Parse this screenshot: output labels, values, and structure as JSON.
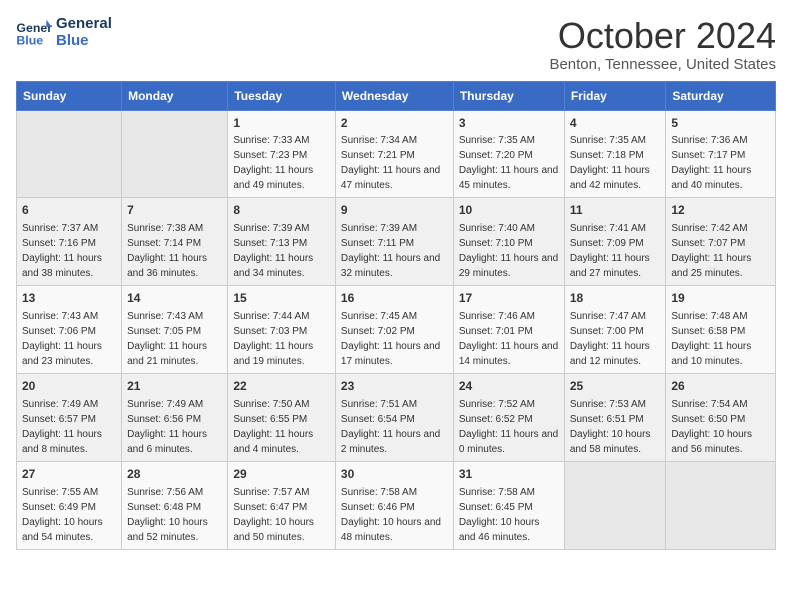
{
  "header": {
    "logo_line1": "General",
    "logo_line2": "Blue",
    "title": "October 2024",
    "subtitle": "Benton, Tennessee, United States"
  },
  "days_of_week": [
    "Sunday",
    "Monday",
    "Tuesday",
    "Wednesday",
    "Thursday",
    "Friday",
    "Saturday"
  ],
  "weeks": [
    [
      {
        "day": "",
        "info": ""
      },
      {
        "day": "",
        "info": ""
      },
      {
        "day": "1",
        "sunrise": "7:33 AM",
        "sunset": "7:23 PM",
        "daylight": "11 hours and 49 minutes."
      },
      {
        "day": "2",
        "sunrise": "7:34 AM",
        "sunset": "7:21 PM",
        "daylight": "11 hours and 47 minutes."
      },
      {
        "day": "3",
        "sunrise": "7:35 AM",
        "sunset": "7:20 PM",
        "daylight": "11 hours and 45 minutes."
      },
      {
        "day": "4",
        "sunrise": "7:35 AM",
        "sunset": "7:18 PM",
        "daylight": "11 hours and 42 minutes."
      },
      {
        "day": "5",
        "sunrise": "7:36 AM",
        "sunset": "7:17 PM",
        "daylight": "11 hours and 40 minutes."
      }
    ],
    [
      {
        "day": "6",
        "sunrise": "7:37 AM",
        "sunset": "7:16 PM",
        "daylight": "11 hours and 38 minutes."
      },
      {
        "day": "7",
        "sunrise": "7:38 AM",
        "sunset": "7:14 PM",
        "daylight": "11 hours and 36 minutes."
      },
      {
        "day": "8",
        "sunrise": "7:39 AM",
        "sunset": "7:13 PM",
        "daylight": "11 hours and 34 minutes."
      },
      {
        "day": "9",
        "sunrise": "7:39 AM",
        "sunset": "7:11 PM",
        "daylight": "11 hours and 32 minutes."
      },
      {
        "day": "10",
        "sunrise": "7:40 AM",
        "sunset": "7:10 PM",
        "daylight": "11 hours and 29 minutes."
      },
      {
        "day": "11",
        "sunrise": "7:41 AM",
        "sunset": "7:09 PM",
        "daylight": "11 hours and 27 minutes."
      },
      {
        "day": "12",
        "sunrise": "7:42 AM",
        "sunset": "7:07 PM",
        "daylight": "11 hours and 25 minutes."
      }
    ],
    [
      {
        "day": "13",
        "sunrise": "7:43 AM",
        "sunset": "7:06 PM",
        "daylight": "11 hours and 23 minutes."
      },
      {
        "day": "14",
        "sunrise": "7:43 AM",
        "sunset": "7:05 PM",
        "daylight": "11 hours and 21 minutes."
      },
      {
        "day": "15",
        "sunrise": "7:44 AM",
        "sunset": "7:03 PM",
        "daylight": "11 hours and 19 minutes."
      },
      {
        "day": "16",
        "sunrise": "7:45 AM",
        "sunset": "7:02 PM",
        "daylight": "11 hours and 17 minutes."
      },
      {
        "day": "17",
        "sunrise": "7:46 AM",
        "sunset": "7:01 PM",
        "daylight": "11 hours and 14 minutes."
      },
      {
        "day": "18",
        "sunrise": "7:47 AM",
        "sunset": "7:00 PM",
        "daylight": "11 hours and 12 minutes."
      },
      {
        "day": "19",
        "sunrise": "7:48 AM",
        "sunset": "6:58 PM",
        "daylight": "11 hours and 10 minutes."
      }
    ],
    [
      {
        "day": "20",
        "sunrise": "7:49 AM",
        "sunset": "6:57 PM",
        "daylight": "11 hours and 8 minutes."
      },
      {
        "day": "21",
        "sunrise": "7:49 AM",
        "sunset": "6:56 PM",
        "daylight": "11 hours and 6 minutes."
      },
      {
        "day": "22",
        "sunrise": "7:50 AM",
        "sunset": "6:55 PM",
        "daylight": "11 hours and 4 minutes."
      },
      {
        "day": "23",
        "sunrise": "7:51 AM",
        "sunset": "6:54 PM",
        "daylight": "11 hours and 2 minutes."
      },
      {
        "day": "24",
        "sunrise": "7:52 AM",
        "sunset": "6:52 PM",
        "daylight": "11 hours and 0 minutes."
      },
      {
        "day": "25",
        "sunrise": "7:53 AM",
        "sunset": "6:51 PM",
        "daylight": "10 hours and 58 minutes."
      },
      {
        "day": "26",
        "sunrise": "7:54 AM",
        "sunset": "6:50 PM",
        "daylight": "10 hours and 56 minutes."
      }
    ],
    [
      {
        "day": "27",
        "sunrise": "7:55 AM",
        "sunset": "6:49 PM",
        "daylight": "10 hours and 54 minutes."
      },
      {
        "day": "28",
        "sunrise": "7:56 AM",
        "sunset": "6:48 PM",
        "daylight": "10 hours and 52 minutes."
      },
      {
        "day": "29",
        "sunrise": "7:57 AM",
        "sunset": "6:47 PM",
        "daylight": "10 hours and 50 minutes."
      },
      {
        "day": "30",
        "sunrise": "7:58 AM",
        "sunset": "6:46 PM",
        "daylight": "10 hours and 48 minutes."
      },
      {
        "day": "31",
        "sunrise": "7:58 AM",
        "sunset": "6:45 PM",
        "daylight": "10 hours and 46 minutes."
      },
      {
        "day": "",
        "info": ""
      },
      {
        "day": "",
        "info": ""
      }
    ]
  ]
}
